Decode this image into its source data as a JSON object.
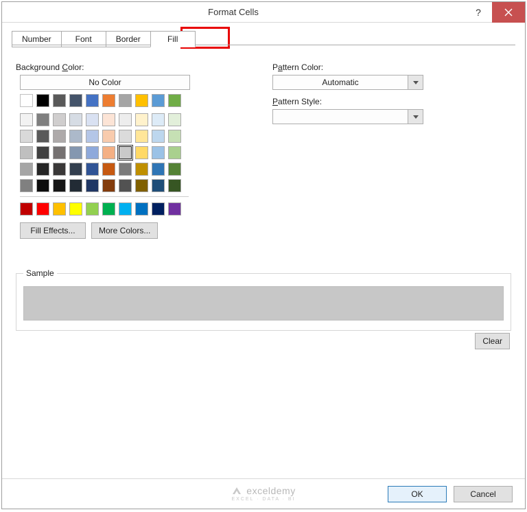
{
  "title": "Format Cells",
  "tabs": {
    "number": "Number",
    "font": "Font",
    "border": "Border",
    "fill": "Fill",
    "active": "Fill"
  },
  "labels": {
    "background_color": "Background Color:",
    "no_color": "No Color",
    "pattern_color": "Pattern Color:",
    "pattern_style": "Pattern Style:",
    "automatic": "Automatic",
    "fill_effects": "Fill Effects...",
    "more_colors": "More Colors...",
    "sample": "Sample",
    "clear": "Clear",
    "ok": "OK",
    "cancel": "Cancel"
  },
  "swatches": {
    "row1": [
      "#ffffff",
      "#000000",
      "#595959",
      "#44546a",
      "#4472c4",
      "#ed7d31",
      "#a5a5a5",
      "#ffc000",
      "#5b9bd5",
      "#70ad47"
    ],
    "grid": [
      [
        "#f2f2f2",
        "#7f7f7f",
        "#d0cece",
        "#d6dce4",
        "#d9e1f2",
        "#fce4d6",
        "#ededed",
        "#fff2cc",
        "#ddebf7",
        "#e2efda"
      ],
      [
        "#d9d9d9",
        "#595959",
        "#aeaaaa",
        "#acb9ca",
        "#b4c6e7",
        "#f8cbad",
        "#dbdbdb",
        "#ffe699",
        "#bdd7ee",
        "#c6e0b4"
      ],
      [
        "#bfbfbf",
        "#404040",
        "#757171",
        "#8497b0",
        "#8ea9db",
        "#f4b084",
        "#c9c9c9",
        "#ffd966",
        "#9bc2e6",
        "#a9d08e"
      ],
      [
        "#a6a6a6",
        "#262626",
        "#3a3838",
        "#333f4f",
        "#305496",
        "#c65911",
        "#7b7b7b",
        "#bf8f00",
        "#2f75b5",
        "#548235"
      ],
      [
        "#808080",
        "#0d0d0d",
        "#161616",
        "#222b35",
        "#203764",
        "#833c0c",
        "#525252",
        "#806000",
        "#1f4e78",
        "#375623"
      ]
    ],
    "standard": [
      "#c00000",
      "#ff0000",
      "#ffc000",
      "#ffff00",
      "#92d050",
      "#00b050",
      "#00b0f0",
      "#0070c0",
      "#002060",
      "#7030a0"
    ],
    "selected": {
      "row": 2,
      "col": 6
    }
  },
  "pattern_style_value": "",
  "watermark": {
    "brand": "exceldemy",
    "sub": "EXCEL · DATA · BI"
  }
}
